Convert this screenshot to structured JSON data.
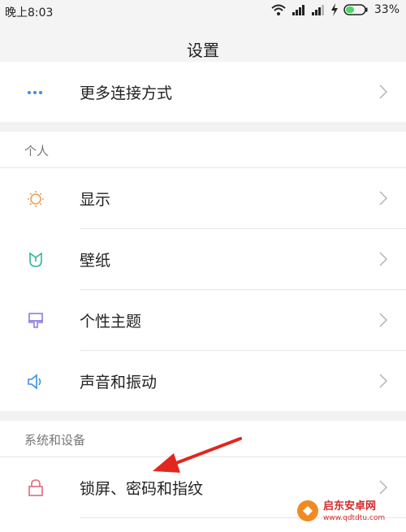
{
  "status_bar": {
    "time": "晚上8:03",
    "battery": "33%",
    "icons": [
      "wifi-icon",
      "signal-icon",
      "signal-icon",
      "charging-icon",
      "battery-icon"
    ],
    "battery_color": "#4cd964"
  },
  "title": "设置",
  "rows": [
    {
      "label": "更多连接方式",
      "icon": "more-dots-icon",
      "icon_color": "#3a8ee6"
    },
    {
      "label": "显示",
      "icon": "sun-icon",
      "icon_color": "#e8a05a"
    },
    {
      "label": "壁纸",
      "icon": "tulip-icon",
      "icon_color": "#2cb59a"
    },
    {
      "label": "个性主题",
      "icon": "brush-icon",
      "icon_color": "#8a7de0"
    },
    {
      "label": "声音和振动",
      "icon": "speaker-icon",
      "icon_color": "#3a8ee6"
    },
    {
      "label": "锁屏、密码和指纹",
      "icon": "lock-icon",
      "icon_color": "#e06b7a"
    }
  ],
  "sections": [
    {
      "title": "个人"
    },
    {
      "title": "系统和设备"
    }
  ],
  "annotation": {
    "arrow_color": "#e0281f"
  },
  "watermark": {
    "text": "启东安卓网",
    "url": "www.qdtdtu.com",
    "color": "#d12a2a"
  }
}
